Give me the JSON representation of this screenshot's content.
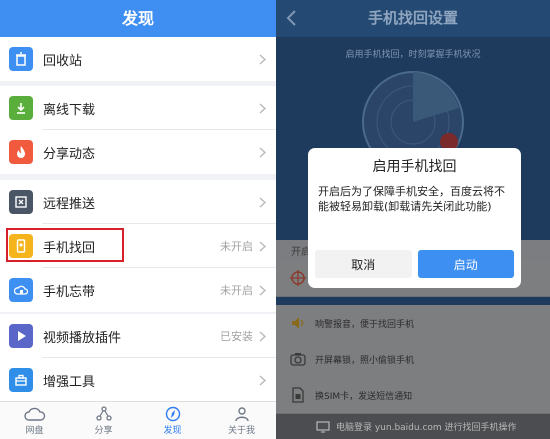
{
  "left": {
    "title": "发现",
    "items": [
      {
        "label": "回收站",
        "status": "",
        "icon": "recycle-bin-icon",
        "color": "#3d8ff1"
      },
      {
        "label": "离线下载",
        "status": "",
        "icon": "download-icon",
        "color": "#5aae3b"
      },
      {
        "label": "分享动态",
        "status": "",
        "icon": "flame-icon",
        "color": "#f25a3e"
      },
      {
        "label": "远程推送",
        "status": "",
        "icon": "remote-push-icon",
        "color": "#4a5566"
      },
      {
        "label": "手机找回",
        "status": "未开启",
        "icon": "phone-locate-icon",
        "color": "#f5b41c"
      },
      {
        "label": "手机忘带",
        "status": "未开启",
        "icon": "cloud-phone-icon",
        "color": "#3d8ff1"
      },
      {
        "label": "视频播放插件",
        "status": "已安装",
        "icon": "play-icon",
        "color": "#5a66c8"
      },
      {
        "label": "增强工具",
        "status": "",
        "icon": "toolbox-icon",
        "color": "#2f8fe8"
      }
    ],
    "tabs": [
      {
        "label": "网盘",
        "icon": "cloud-icon"
      },
      {
        "label": "分享",
        "icon": "share-icon"
      },
      {
        "label": "发现",
        "icon": "compass-icon",
        "active": true
      },
      {
        "label": "关于我",
        "icon": "person-icon"
      }
    ]
  },
  "right": {
    "title": "手机找回设置",
    "subtitle": "启用手机找回，时刻掌握手机状况",
    "options_header": "开启",
    "options": [
      {
        "text": "",
        "icon": "target-icon"
      },
      {
        "text": "响警报音，便于找回手机",
        "icon": "speaker-icon"
      },
      {
        "text": "开屏幕锁，照小偷锁手机",
        "icon": "camera-icon"
      },
      {
        "text": "换SIM卡，发送短信通知",
        "icon": "sim-card-icon"
      }
    ],
    "footer": "电脑登录 yun.baidu.com 进行找回手机操作"
  },
  "dialog": {
    "title": "启用手机找回",
    "message": "开启后为了保障手机安全，百度云将不能被轻易卸载(卸载请先关闭此功能)",
    "cancel": "取消",
    "confirm": "启动"
  },
  "colors": {
    "accent": "#3f8ef2",
    "highlight_box": "#d5202a",
    "dark_panel": "#1e3a5c"
  }
}
